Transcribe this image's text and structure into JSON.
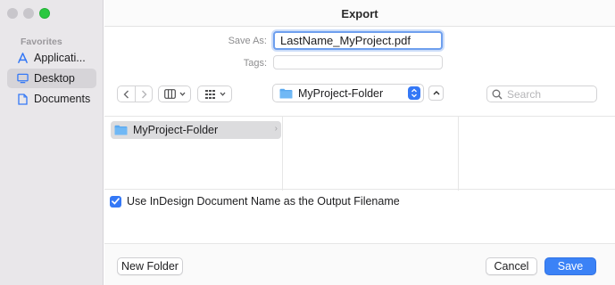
{
  "window": {
    "title": "Export"
  },
  "sidebar": {
    "section_title": "Favorites",
    "items": [
      {
        "label": "Applicati...",
        "icon": "applications-icon"
      },
      {
        "label": "Desktop",
        "icon": "desktop-icon"
      },
      {
        "label": "Documents",
        "icon": "documents-icon"
      }
    ]
  },
  "form": {
    "save_as_label": "Save As:",
    "save_as_value": "LastName_MyProject.pdf",
    "tags_label": "Tags:"
  },
  "toolbar": {
    "location": "MyProject-Folder",
    "search_placeholder": "Search"
  },
  "browser": {
    "columns": [
      {
        "items": [
          {
            "label": "MyProject-Folder"
          }
        ]
      },
      {
        "items": []
      },
      {
        "items": []
      }
    ]
  },
  "options": {
    "use_doc_name_label": "Use InDesign Document Name as the Output Filename",
    "use_doc_name_checked": true
  },
  "footer": {
    "new_folder_label": "New Folder",
    "cancel_label": "Cancel",
    "save_label": "Save"
  },
  "colors": {
    "accent": "#3478f6",
    "folder": "#5aa9f0",
    "sidebar_bg": "#e9e7ea"
  }
}
